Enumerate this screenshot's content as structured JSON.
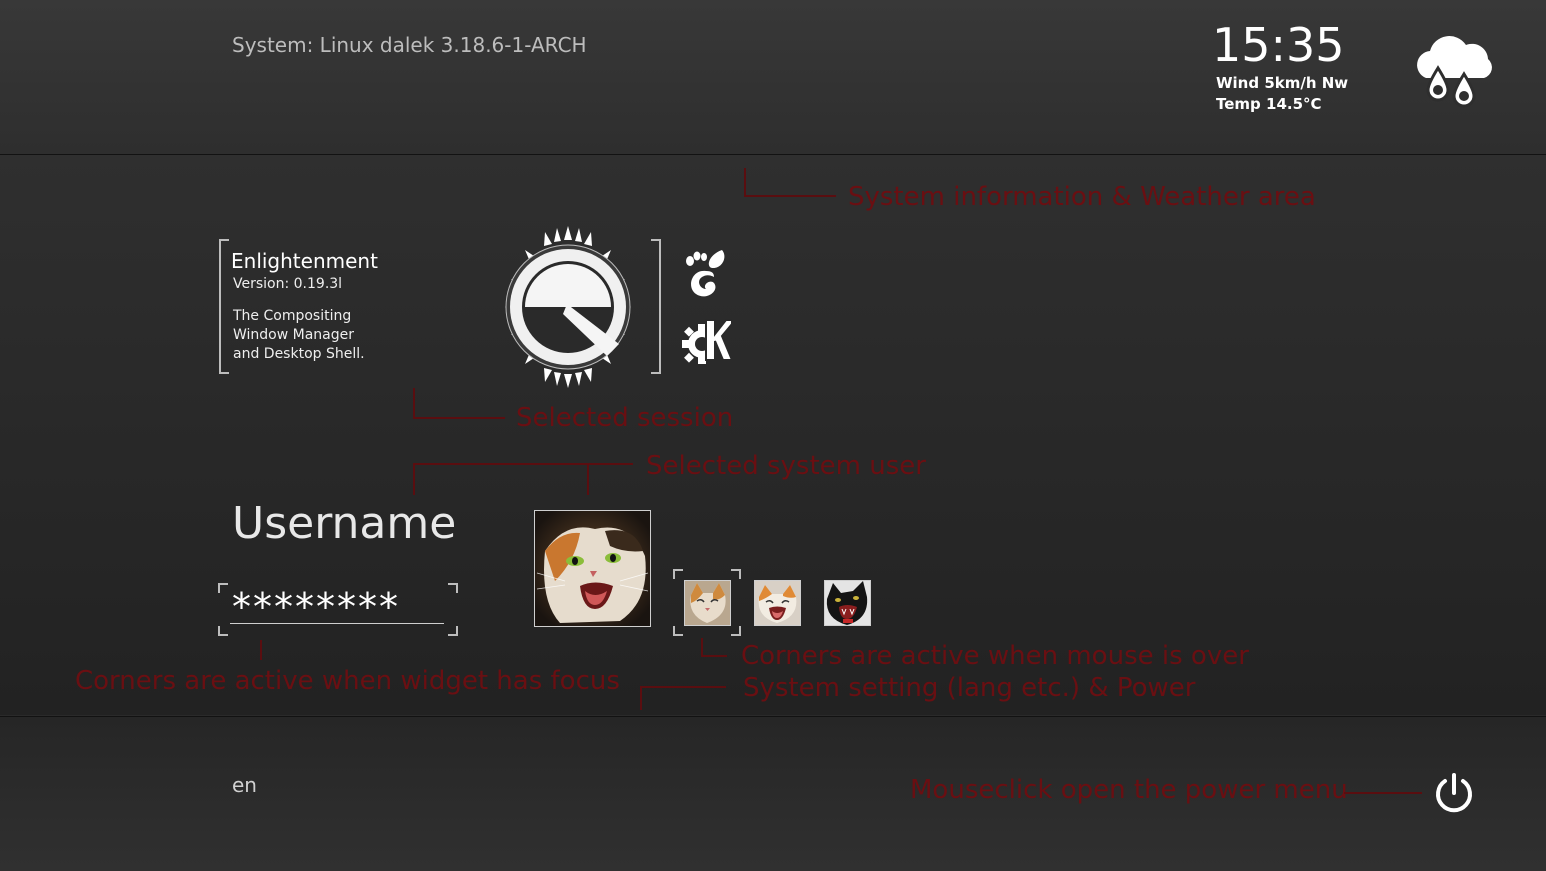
{
  "system": {
    "info": "System: Linux dalek 3.18.6-1-ARCH",
    "time": "15:35",
    "wind": "Wind 5km/h Nw",
    "temp": "Temp 14.5°C",
    "weather_icon": "rain-cloud-icon"
  },
  "session": {
    "name": "Enlightenment",
    "version": "Version: 0.19.3l",
    "desc1": "The Compositing",
    "desc2": "Window Manager",
    "desc3": "and Desktop Shell.",
    "logo_icon": "enlightenment-logo-icon",
    "alt_sessions": [
      "gnome-icon",
      "kde-icon"
    ]
  },
  "login": {
    "username": "Username",
    "password": "********"
  },
  "bottom": {
    "lang": "en",
    "power_icon": "power-icon"
  },
  "annotations": {
    "sysweather": "System information & Weather area",
    "session": "Selected session",
    "user": "Selected system user",
    "focus": "Corners are active when widget has focus",
    "mouse": "Corners are active when mouse is over",
    "settings": "System setting (lang etc.) & Power",
    "power": "Mouseclick open the power menu"
  },
  "colors": {
    "annotation": "#6a0f12",
    "text": "#d8d8d8"
  }
}
